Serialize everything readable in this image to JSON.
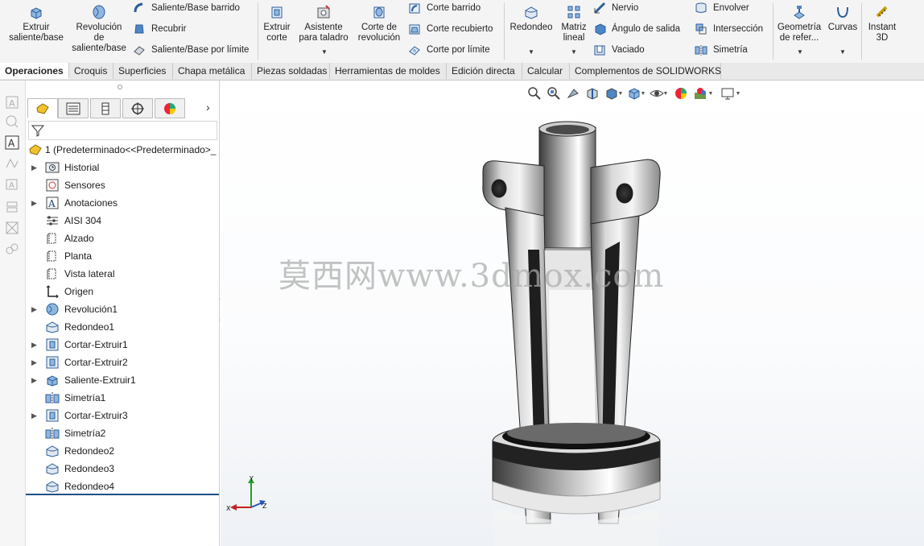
{
  "ribbon": {
    "extrude_boss": "Extruir saliente/base",
    "revolve_boss": "Revolución de saliente/base",
    "swept_boss": "Saliente/Base barrido",
    "loft_boss": "Recubrir",
    "boundary_boss": "Saliente/Base por límite",
    "extrude_cut": "Extruir corte",
    "hole_wizard": "Asistente para taladro",
    "revolve_cut": "Corte de revolución",
    "swept_cut": "Corte barrido",
    "loft_cut": "Corte recubierto",
    "boundary_cut": "Corte por límite",
    "fillet": "Redondeo",
    "linear_pattern": "Matriz lineal",
    "rib": "Nervio",
    "draft": "Ángulo de salida",
    "shell": "Vaciado",
    "wrap": "Envolver",
    "intersect": "Intersección",
    "mirror": "Simetría",
    "ref_geometry": "Geometría de refer...",
    "curves": "Curvas",
    "instant3d": "Instant 3D"
  },
  "tabs": [
    {
      "label": "Operaciones"
    },
    {
      "label": "Croquis"
    },
    {
      "label": "Superficies"
    },
    {
      "label": "Chapa metálica"
    },
    {
      "label": "Piezas soldadas"
    },
    {
      "label": "Herramientas de moldes"
    },
    {
      "label": "Edición directa"
    },
    {
      "label": "Calcular"
    },
    {
      "label": "Complementos de SOLIDWORKS"
    }
  ],
  "feature_tree": {
    "root": "1  (Predeterminado<<Predeterminado>_",
    "items": [
      {
        "label": "Historial",
        "icon": "history-icon"
      },
      {
        "label": "Sensores",
        "icon": "sensor-icon"
      },
      {
        "label": "Anotaciones",
        "icon": "annotation-icon"
      },
      {
        "label": "AISI 304",
        "icon": "material-icon"
      },
      {
        "label": "Alzado",
        "icon": "plane-icon"
      },
      {
        "label": "Planta",
        "icon": "plane-icon"
      },
      {
        "label": "Vista lateral",
        "icon": "plane-icon"
      },
      {
        "label": "Origen",
        "icon": "origin-icon"
      },
      {
        "label": "Revolución1",
        "icon": "revolve-icon"
      },
      {
        "label": "Redondeo1",
        "icon": "fillet-icon"
      },
      {
        "label": "Cortar-Extruir1",
        "icon": "cut-extrude-icon"
      },
      {
        "label": "Cortar-Extruir2",
        "icon": "cut-extrude-icon"
      },
      {
        "label": "Saliente-Extruir1",
        "icon": "boss-extrude-icon"
      },
      {
        "label": "Simetría1",
        "icon": "mirror-icon"
      },
      {
        "label": "Cortar-Extruir3",
        "icon": "cut-extrude-icon"
      },
      {
        "label": "Simetría2",
        "icon": "mirror-icon"
      },
      {
        "label": "Redondeo2",
        "icon": "fillet-icon"
      },
      {
        "label": "Redondeo3",
        "icon": "fillet-icon"
      },
      {
        "label": "Redondeo4",
        "icon": "fillet-icon"
      }
    ]
  },
  "watermark": "莫西网www.3dmox.com",
  "axes": {
    "x": "X",
    "y": "Y",
    "z": "Z"
  },
  "colors": {
    "accent": "#1f4f86",
    "ribbon_bg": "#f4f4f4"
  }
}
